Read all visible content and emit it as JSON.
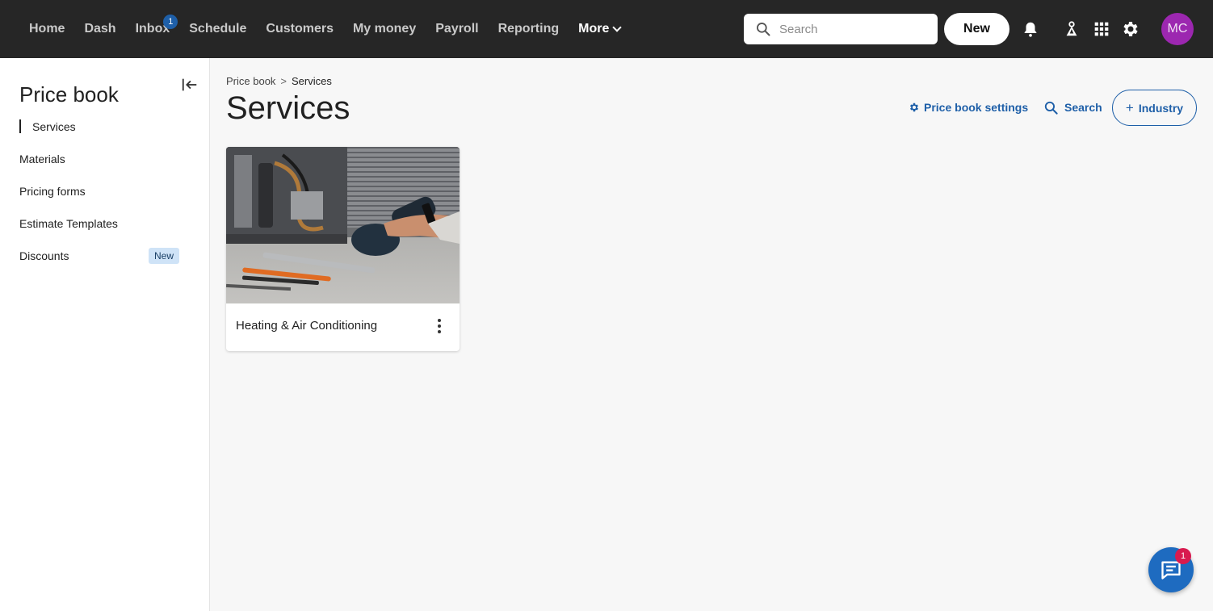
{
  "topbar": {
    "nav": [
      {
        "label": "Home"
      },
      {
        "label": "Dash"
      },
      {
        "label": "Inbox",
        "badge": "1"
      },
      {
        "label": "Schedule"
      },
      {
        "label": "Customers"
      },
      {
        "label": "My money"
      },
      {
        "label": "Payroll"
      },
      {
        "label": "Reporting"
      },
      {
        "label": "More"
      }
    ],
    "search_placeholder": "Search",
    "new_label": "New",
    "avatar_initials": "MC",
    "icons": [
      "search-icon",
      "bell-icon",
      "location-icon",
      "apps-grid-icon",
      "gear-icon"
    ]
  },
  "sidebar": {
    "title": "Price book",
    "items": [
      {
        "label": "Services",
        "active": true
      },
      {
        "label": "Materials"
      },
      {
        "label": "Pricing forms"
      },
      {
        "label": "Estimate Templates"
      },
      {
        "label": "Discounts",
        "badge": "New"
      }
    ]
  },
  "breadcrumb": {
    "parent": "Price book",
    "separator": ">",
    "current": "Services"
  },
  "main": {
    "title": "Services",
    "actions": {
      "settings_label": "Price book settings",
      "search_label": "Search",
      "industry_label": "Industry",
      "industry_prefix": "+"
    },
    "cards": [
      {
        "label": "Heating & Air Conditioning",
        "image": "hvac-repair-photo"
      }
    ]
  },
  "chat": {
    "badge": "1"
  },
  "colors": {
    "topbar": "#262626",
    "accent": "#1e5fa8",
    "avatar": "#9c27b0",
    "chat_badge": "#d81b4f",
    "new_badge": "#cfe3f7"
  }
}
